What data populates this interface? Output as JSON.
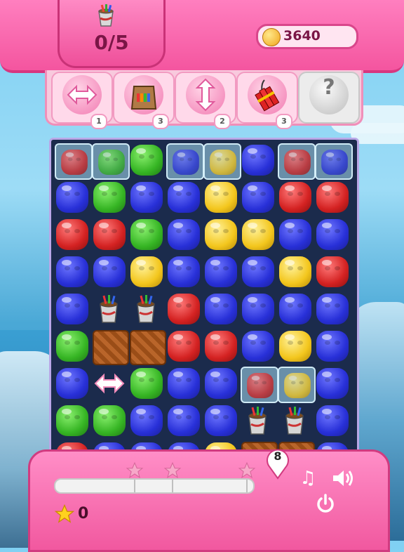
{
  "goal": {
    "collected": "0/5",
    "item_icon": "paint-bucket-icon"
  },
  "coins": {
    "value": "3640",
    "icon": "coin-icon"
  },
  "boosters": [
    {
      "name": "horizontal-arrows",
      "count": "1",
      "color": "#f27bb2"
    },
    {
      "name": "paint-bag",
      "count": "3",
      "color": "#f27bb2"
    },
    {
      "name": "vertical-arrows",
      "count": "2",
      "color": "#f27bb2"
    },
    {
      "name": "dynamite",
      "count": "3",
      "color": "#f27bb2"
    },
    {
      "name": "locked",
      "count": "",
      "label": "?"
    }
  ],
  "board": {
    "rows": [
      [
        "ice-red",
        "ice-green",
        "green",
        "ice-blue",
        "ice-yellow",
        "blue",
        "ice-red",
        "ice-blue"
      ],
      [
        "blue",
        "green",
        "blue",
        "blue",
        "yellow",
        "blue",
        "red",
        "red"
      ],
      [
        "red",
        "red",
        "green",
        "blue",
        "yellow",
        "yellow",
        "blue",
        "blue"
      ],
      [
        "blue",
        "blue",
        "yellow",
        "blue",
        "blue",
        "blue",
        "yellow",
        "red"
      ],
      [
        "blue",
        "bucket",
        "bucket",
        "red",
        "blue",
        "blue",
        "blue",
        "blue"
      ],
      [
        "green",
        "crate",
        "crate",
        "red",
        "red",
        "blue",
        "yellow",
        "blue"
      ],
      [
        "blue",
        "arrows",
        "green",
        "blue",
        "blue",
        "ice-red",
        "ice-yellow",
        "blue"
      ],
      [
        "green",
        "green",
        "blue",
        "blue",
        "blue",
        "bucket",
        "bucket",
        "blue"
      ],
      [
        "red",
        "blue",
        "blue",
        "blue",
        "yellow",
        "crate",
        "crate",
        "blue"
      ]
    ],
    "colors": {
      "blue": "#2830d8",
      "green": "#36b524",
      "red": "#d42222",
      "yellow": "#f3c61d"
    }
  },
  "bottom": {
    "moves_left": "8",
    "stars_earned": "0",
    "progress": 0,
    "star_thresholds": 3,
    "music_icon": "music-note-icon",
    "sound_icon": "speaker-icon",
    "power_icon": "power-icon"
  }
}
